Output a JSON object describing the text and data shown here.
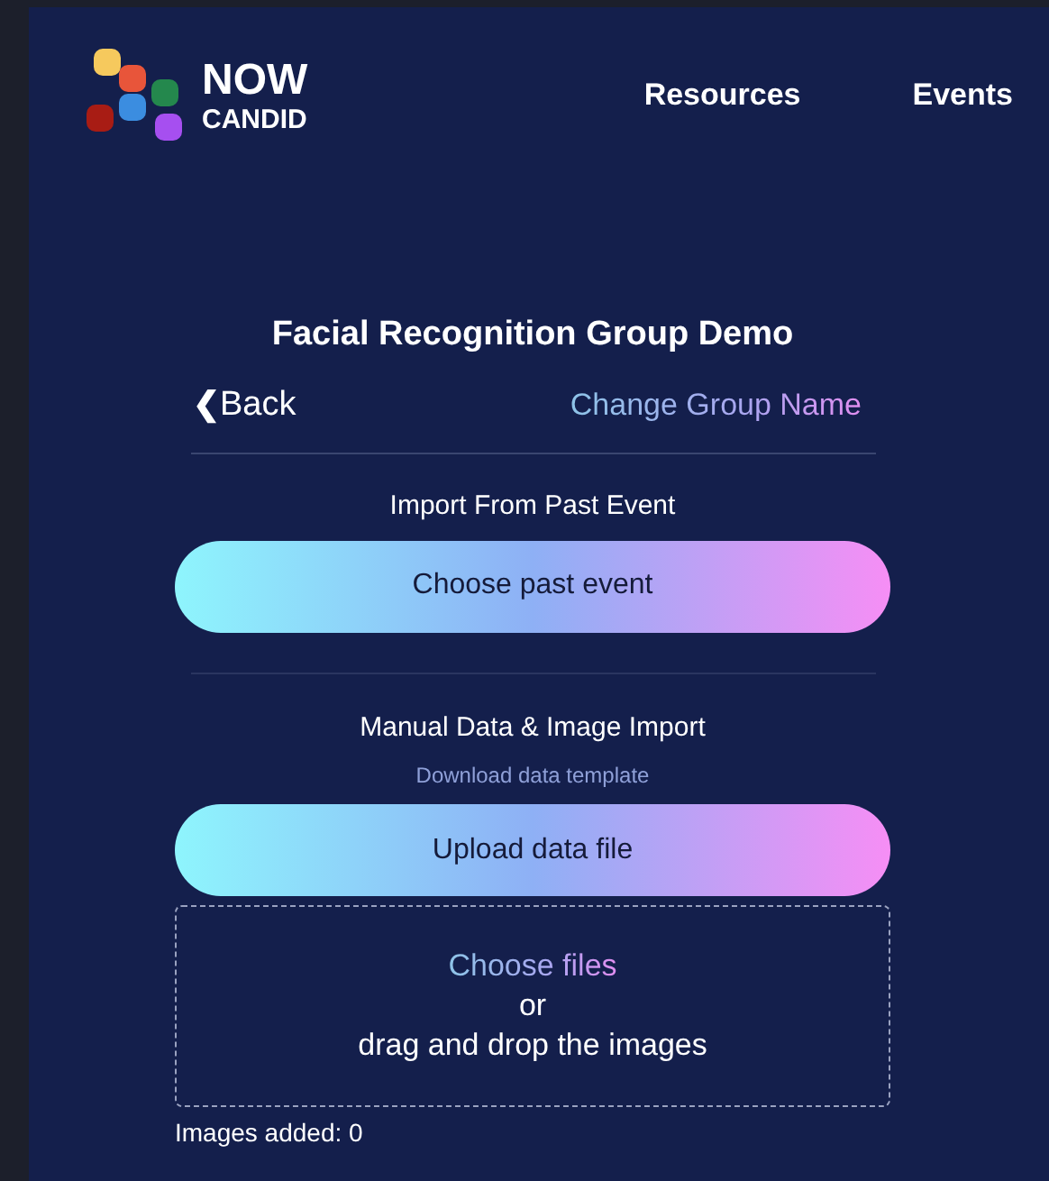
{
  "logo": {
    "line_1": "NOW",
    "line_2": "CANDID"
  },
  "nav": [
    "Resources",
    "Events"
  ],
  "title": "Facial Recognition Group Demo",
  "back_link": {
    "icon": "❮",
    "label": "Back"
  },
  "rename_link": "Change Group Name",
  "past_event": {
    "heading": "Import From Past Event",
    "button": "Choose past event"
  },
  "manual_import": {
    "heading": "Manual Data & Image Import",
    "template_link": "Download data template",
    "button": "Upload data file"
  },
  "drop_zone": {
    "link": "Choose files",
    "or": "or",
    "hint": "drag and drop the images"
  },
  "images_added": "Images added: 0"
}
